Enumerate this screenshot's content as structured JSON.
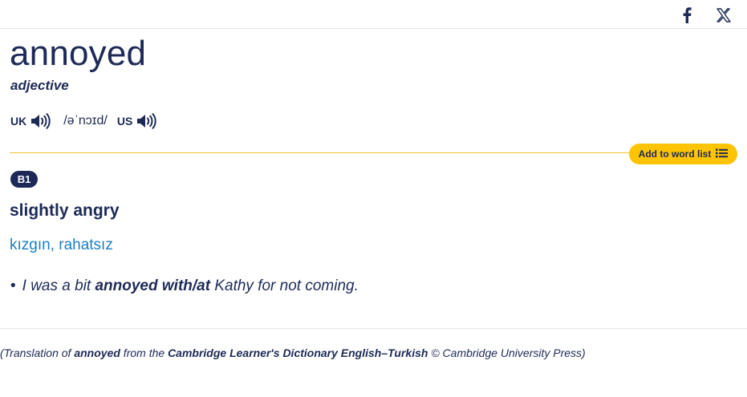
{
  "share": {
    "facebook_icon": "facebook-icon",
    "x_icon": "x-twitter-icon"
  },
  "entry": {
    "headword": "annoyed",
    "part_of_speech": "adjective",
    "pronunciation": {
      "uk_label": "UK",
      "ipa": "/əˈnɔɪd/",
      "us_label": "US",
      "speaker_icon": "speaker-icon"
    },
    "add_to_word_list": "Add to word list",
    "word_list_icon": "list-icon",
    "level": "B1",
    "definition": "slightly angry",
    "translation": "kızgın, rahatsız",
    "example": {
      "bullet": "•",
      "before": "I was a bit ",
      "bold": "annoyed with/at",
      "after": " Kathy for not coming."
    }
  },
  "credit": {
    "open": "(Translation of ",
    "word": "annoyed",
    "from": " from the ",
    "dictionary": "Cambridge Learner's Dictionary English–Turkish",
    "publisher": " © Cambridge University Press)"
  },
  "colors": {
    "navy": "#1d2a57",
    "link_blue": "#1a7fc6",
    "accent_yellow": "#fec400"
  }
}
